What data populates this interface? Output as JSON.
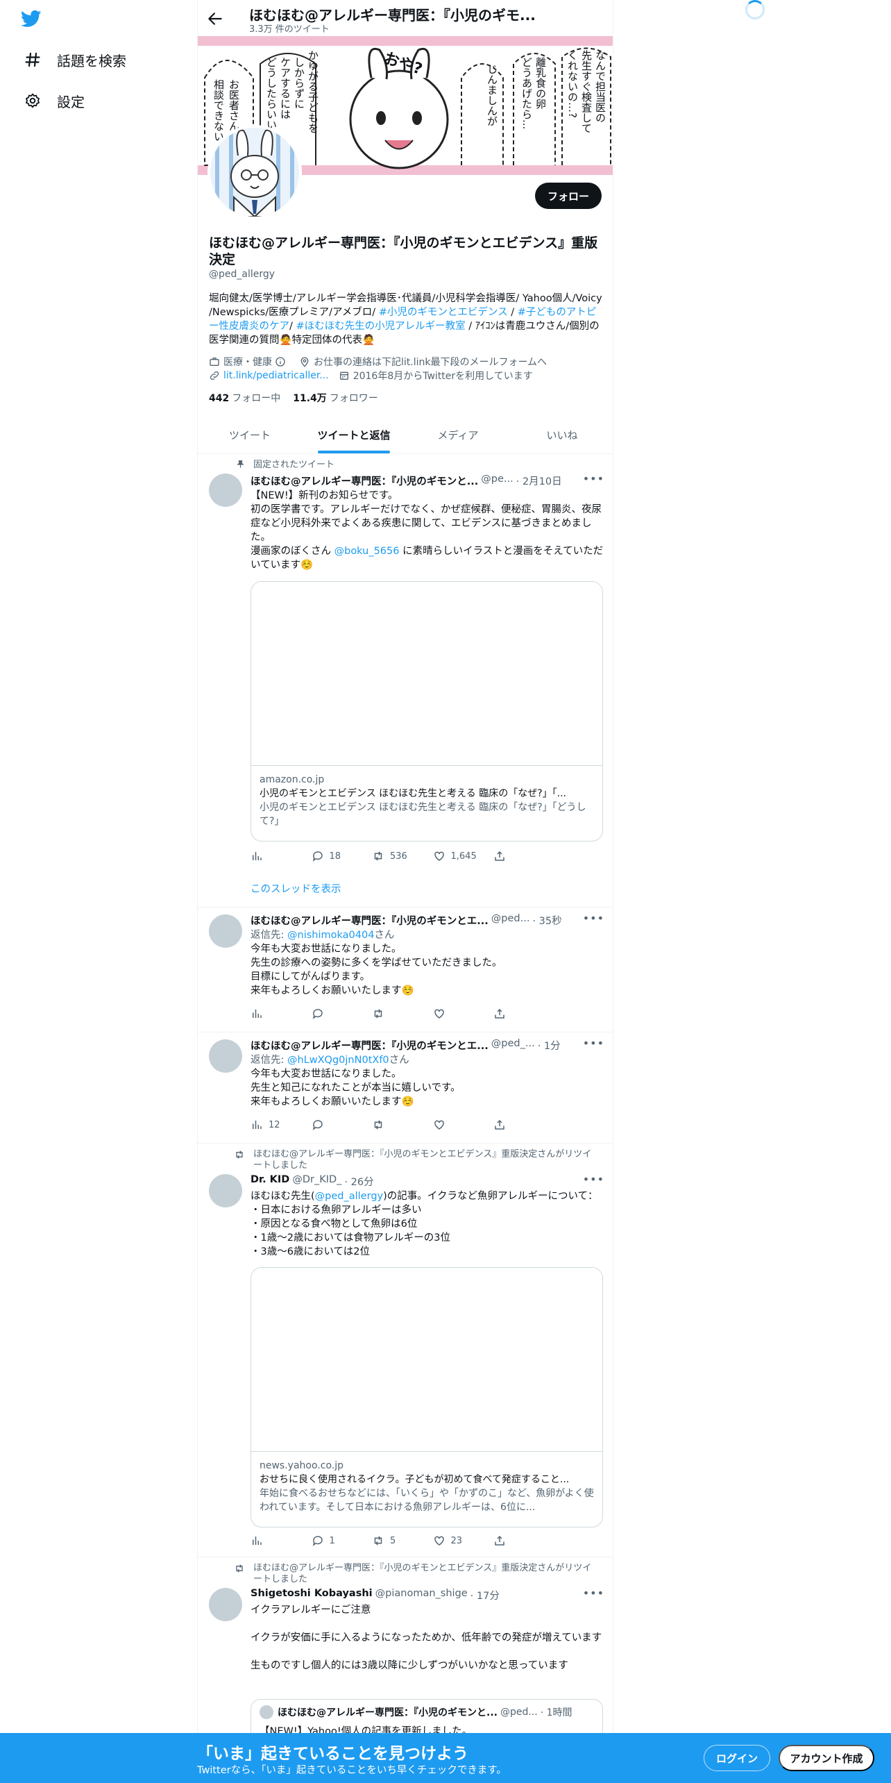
{
  "sidebar": {
    "items": [
      {
        "label": "話題を検索",
        "icon": "hashtag-icon"
      },
      {
        "label": "設定",
        "icon": "gear-icon"
      }
    ]
  },
  "header": {
    "title": "ほむほむ@アレルギー専門医：『小児のギモ...",
    "subtitle": "3.3万 件のツイート"
  },
  "banner": {
    "bubbles": [
      "相談できない",
      "お医者さんに",
      "どうしたらいい",
      "ケアするには",
      "しからずに",
      "かゆがる子どもを",
      "おや?",
      "じんましんが",
      "どうあげたら...",
      "離乳食の卵",
      "くれないの…?",
      "先生すぐ検査して",
      "なんで担当医の"
    ]
  },
  "profile": {
    "follow_label": "フォロー",
    "name": "ほむほむ@アレルギー専門医：『小児のギモンとエビデンス』重版決定",
    "handle": "@ped_allergy",
    "bio_plain1": "堀向健太/医学博士/アレルギー学会指導医･代議員/小児科学会指導医/ Yahoo個人/Voicy /Newspicks/医療プレミア/アメブロ/ ",
    "bio_tag1": "#小児のギモンとエビデンス",
    "bio_sep1": " / ",
    "bio_tag2": "#子どものアトピー性皮膚炎のケア",
    "bio_sep2": "/ ",
    "bio_tag3": "#ほむほむ先生の小児アレルギー教室",
    "bio_plain2": " / ｱｲｺﾝは青鹿ユウさん/個別の医学関連の質問🙅特定団体の代表🙅",
    "category": "医療・健康",
    "location": "お仕事の連絡は下記lit.link最下段のメールフォームへ",
    "website": "lit.link/pediatricaller...",
    "joined": "2016年8月からTwitterを利用しています",
    "following_count": "442",
    "following_label": "フォロー中",
    "followers_count": "11.4万",
    "followers_label": "フォロワー"
  },
  "tabs": [
    "ツイート",
    "ツイートと返信",
    "メディア",
    "いいね"
  ],
  "tweets": [
    {
      "context": "固定されたツイート",
      "name": "ほむほむ@アレルギー専門医：『小児のギモンと...",
      "handle": "@pe...",
      "time": "· 2月10日",
      "body_text": "【NEW!】新刊のお知らせです。\n初の医学書です。アレルギーだけでなく、かぜ症候群、便秘症、胃腸炎、夜尿症など小児科外来でよくある疾患に関して、エビデンスに基づきまとめました。\n漫画家のぼくさん ",
      "body_link": "@boku_5656",
      "body_text2": " に素晴らしいイラストと漫画をそえていただいています☺️",
      "card_domain": "amazon.co.jp",
      "card_title": "小児のギモンとエビデンス ほむほむ先生と考える 臨床の「なぜ?」「...",
      "card_desc": "小児のギモンとエビデンス ほむほむ先生と考える 臨床の「なぜ?」「どうして?」",
      "replies": "18",
      "retweets": "536",
      "likes": "1,645",
      "show_thread": "このスレッドを表示"
    },
    {
      "name": "ほむほむ@アレルギー専門医：『小児のギモンとエ...",
      "handle": "@ped...",
      "time": "· 35秒",
      "reply_prefix": "返信先: ",
      "reply_to": "@nishimoka0404",
      "reply_suffix": "さん",
      "body_text": "今年も大変お世話になりました。\n先生の診療への姿勢に多くを学ばせていただきました。\n目標にしてがんばります。\n来年もよろしくお願いいたします☺️"
    },
    {
      "name": "ほむほむ@アレルギー専門医：『小児のギモンとエ...",
      "handle": "@ped_...",
      "time": "· 1分",
      "reply_prefix": "返信先: ",
      "reply_to": "@hLwXQg0jnN0tXf0",
      "reply_suffix": "さん",
      "body_text": "今年も大変お世話になりました。\n先生と知己になれたことが本当に嬉しいです。\n来年もよろしくお願いいたします☺️",
      "views": "12"
    },
    {
      "context": "ほむほむ@アレルギー専門医：『小児のギモンとエビデンス』重版決定さんがリツイートしました",
      "name": "Dr. KID",
      "handle": "@Dr_KID_",
      "time": "· 26分",
      "body_text": "ほむほむ先生(",
      "body_link": "@ped_allergy",
      "body_text2": ")の記事。イクラなど魚卵アレルギーについて：\n・日本における魚卵アレルギーは多い\n・原因となる食べ物として魚卵は6位\n・1歳～2歳においては食物アレルギーの3位\n・3歳～6歳においては2位",
      "card_domain": "news.yahoo.co.jp",
      "card_title": "おせちに良く使用されるイクラ。子どもが初めて食べて発症すること...",
      "card_desc": "年始に食べるおせちなどには、「いくら」や「かずのこ」など、魚卵がよく使われています。そして日本における魚卵アレルギーは、6位に...",
      "replies": "1",
      "retweets": "5",
      "likes": "23"
    },
    {
      "context": "ほむほむ@アレルギー専門医：『小児のギモンとエビデンス』重版決定さんがリツイートしました",
      "name": "Shigetoshi Kobayashi",
      "handle": "@pianoman_shige",
      "time": "· 17分",
      "body_text": "イクラアレルギーにご注意\n\nイクラが安価に手に入るようになったためか、低年齢での発症が増えています\n\n生ものですし個人的には3歳以降に少しずつがいいかなと思っています",
      "quote_name": "ほむほむ@アレルギー専門医：『小児のギモンと...",
      "quote_handle": "@ped...",
      "quote_time": "· 1時間",
      "quote_text": "【NEW!】Yahoo!個人の記事を更新しました。"
    }
  ],
  "bottom_bar": {
    "title": "「いま」起きていることを見つけよう",
    "subtitle": "Twitterなら、「いま」起きていることをいち早くチェックできます。",
    "login": "ログイン",
    "signup": "アカウント作成"
  },
  "colors": {
    "accent": "#1d9bf0",
    "text": "#0f1419",
    "muted": "#536471",
    "banner_pink": "#f2bfd2"
  }
}
